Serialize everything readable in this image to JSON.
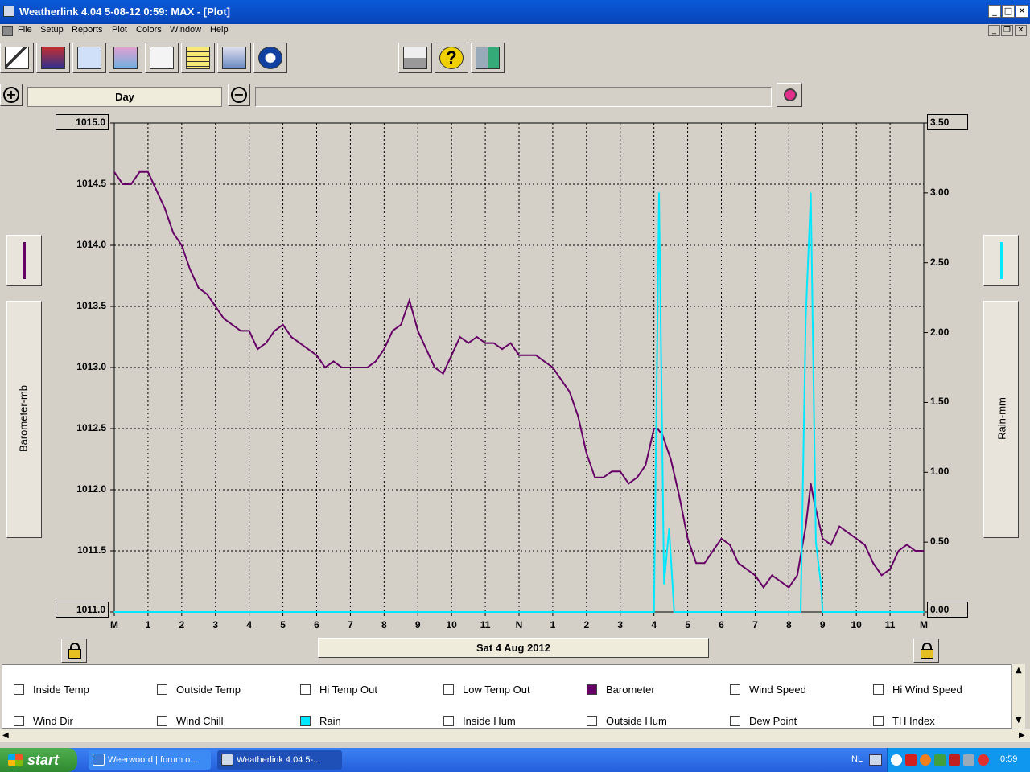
{
  "window": {
    "title": "Weatherlink 4.04   5-08-12   0:59: MAX - [Plot]"
  },
  "menu": [
    "File",
    "Setup",
    "Reports",
    "Plot",
    "Colors",
    "Window",
    "Help"
  ],
  "toolbar": {
    "left_icons": [
      "wind-vane-icon",
      "station-icon",
      "bulletin-icon",
      "summary-icon",
      "graph-icon",
      "notepad-icon",
      "rain-cloud-icon",
      "noaa-icon"
    ],
    "right_icons": [
      "printer-icon",
      "help-icon",
      "exit-icon"
    ]
  },
  "zoom": {
    "period": "Day",
    "range": ""
  },
  "plot": {
    "left_axis_label": "Barometer-mb",
    "right_axis_label": "Rain-mm",
    "left_top": "1015.0",
    "left_bottom": "1011.0",
    "right_top": "3.50",
    "right_bottom": "0.00",
    "date": "Sat 4 Aug 2012"
  },
  "chart_data": {
    "type": "line",
    "x_ticks": [
      "M",
      "1",
      "2",
      "3",
      "4",
      "5",
      "6",
      "7",
      "8",
      "9",
      "10",
      "11",
      "N",
      "1",
      "2",
      "3",
      "4",
      "5",
      "6",
      "7",
      "8",
      "9",
      "10",
      "11",
      "M"
    ],
    "left_y_ticks": [
      "1015.0",
      "1014.5",
      "1014.0",
      "1013.5",
      "1013.0",
      "1012.5",
      "1012.0",
      "1011.5",
      "1011.0"
    ],
    "right_y_ticks": [
      "3.50",
      "3.00",
      "2.50",
      "2.00",
      "1.50",
      "1.00",
      "0.50",
      "0.00"
    ],
    "left_ylim": [
      1011.0,
      1015.0
    ],
    "right_ylim": [
      0.0,
      3.5
    ],
    "xlim": [
      0,
      24
    ],
    "grid": true,
    "series": [
      {
        "name": "Barometer",
        "color": "#660066",
        "axis": "left",
        "x": [
          0,
          0.25,
          0.5,
          0.75,
          1,
          1.25,
          1.5,
          1.75,
          2,
          2.25,
          2.5,
          2.75,
          3,
          3.25,
          3.5,
          3.75,
          4,
          4.25,
          4.5,
          4.75,
          5,
          5.25,
          5.5,
          5.75,
          6,
          6.25,
          6.5,
          6.75,
          7,
          7.25,
          7.5,
          7.75,
          8,
          8.25,
          8.5,
          8.75,
          9,
          9.25,
          9.5,
          9.75,
          10,
          10.25,
          10.5,
          10.75,
          11,
          11.25,
          11.5,
          11.75,
          12,
          12.25,
          12.5,
          12.75,
          13,
          13.25,
          13.5,
          13.75,
          14,
          14.25,
          14.5,
          14.75,
          15,
          15.25,
          15.5,
          15.75,
          16,
          16.1,
          16.25,
          16.5,
          16.75,
          17,
          17.25,
          17.5,
          17.75,
          18,
          18.25,
          18.5,
          18.75,
          19,
          19.25,
          19.5,
          19.75,
          20,
          20.25,
          20.5,
          20.65,
          20.75,
          21,
          21.25,
          21.5,
          21.75,
          22,
          22.25,
          22.5,
          22.75,
          23,
          23.25,
          23.5,
          23.75,
          24
        ],
        "y": [
          1014.6,
          1014.5,
          1014.5,
          1014.6,
          1014.6,
          1014.45,
          1014.3,
          1014.1,
          1014.0,
          1013.8,
          1013.65,
          1013.6,
          1013.5,
          1013.4,
          1013.35,
          1013.3,
          1013.3,
          1013.15,
          1013.2,
          1013.3,
          1013.35,
          1013.25,
          1013.2,
          1013.15,
          1013.1,
          1013.0,
          1013.05,
          1013.0,
          1013.0,
          1013.0,
          1013.0,
          1013.05,
          1013.15,
          1013.3,
          1013.35,
          1013.55,
          1013.3,
          1013.15,
          1013.0,
          1012.95,
          1013.1,
          1013.25,
          1013.2,
          1013.25,
          1013.2,
          1013.2,
          1013.15,
          1013.2,
          1013.1,
          1013.1,
          1013.1,
          1013.05,
          1013.0,
          1012.9,
          1012.8,
          1012.6,
          1012.3,
          1012.1,
          1012.1,
          1012.15,
          1012.15,
          1012.05,
          1012.1,
          1012.2,
          1012.5,
          1012.5,
          1012.45,
          1012.25,
          1011.95,
          1011.6,
          1011.4,
          1011.4,
          1011.5,
          1011.6,
          1011.55,
          1011.4,
          1011.35,
          1011.3,
          1011.2,
          1011.3,
          1011.25,
          1011.2,
          1011.3,
          1011.7,
          1012.05,
          1011.9,
          1011.6,
          1011.55,
          1011.7,
          1011.65,
          1011.6,
          1011.55,
          1011.4,
          1011.3,
          1011.35,
          1011.5,
          1011.55,
          1011.5,
          1011.5
        ],
        "values_note": ""
      },
      {
        "name": "Rain",
        "color": "#00e8ff",
        "axis": "right",
        "x": [
          0,
          16.0,
          16.15,
          16.3,
          16.45,
          16.6,
          16.75,
          17.0,
          20.35,
          20.5,
          20.65,
          20.8,
          20.95,
          21.0,
          24
        ],
        "y": [
          0,
          0,
          3.0,
          0.2,
          0.6,
          0.0,
          0.0,
          0.0,
          0.0,
          2.1,
          3.0,
          0.5,
          0.2,
          0.0,
          0.0
        ]
      }
    ]
  },
  "legend": {
    "row1": [
      {
        "label": "Inside Temp",
        "color": "#ffffff"
      },
      {
        "label": "Outside Temp",
        "color": "#ffffff"
      },
      {
        "label": "Hi Temp Out",
        "color": "#ffffff"
      },
      {
        "label": "Low Temp Out",
        "color": "#ffffff"
      },
      {
        "label": "Barometer",
        "color": "#660066"
      },
      {
        "label": "Wind Speed",
        "color": "#ffffff"
      },
      {
        "label": "Hi Wind Speed",
        "color": "#ffffff"
      }
    ],
    "row2": [
      {
        "label": "Wind Dir",
        "color": "#ffffff"
      },
      {
        "label": "Wind Chill",
        "color": "#ffffff"
      },
      {
        "label": "Rain",
        "color": "#00e8ff"
      },
      {
        "label": "Inside Hum",
        "color": "#ffffff"
      },
      {
        "label": "Outside Hum",
        "color": "#ffffff"
      },
      {
        "label": "Dew Point",
        "color": "#ffffff"
      },
      {
        "label": "TH Index",
        "color": "#ffffff"
      }
    ]
  },
  "taskbar": {
    "start": "start",
    "tasks": [
      "Weerwoord | forum o...",
      "Weatherlink 4.04   5-..."
    ],
    "language": "NL",
    "clock": "0:59"
  }
}
